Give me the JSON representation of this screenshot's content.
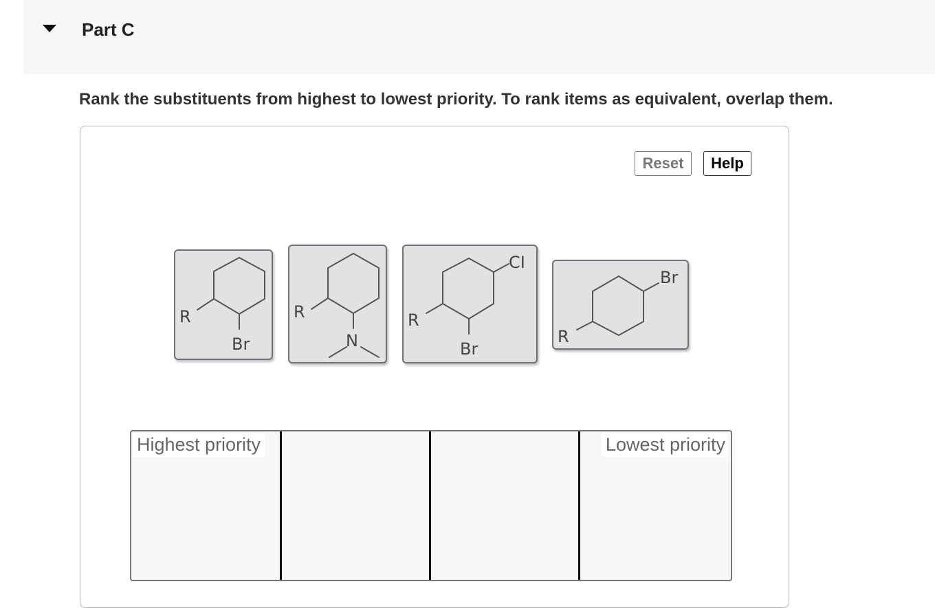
{
  "part": {
    "title": "Part C",
    "expanded": true
  },
  "instructions": "Rank the substituents from highest to lowest priority. To rank items as equivalent, overlap them.",
  "controls": {
    "reset_label": "Reset",
    "help_label": "Help"
  },
  "items": [
    {
      "id": "item-1",
      "labels": [
        "R",
        "Br"
      ]
    },
    {
      "id": "item-2",
      "labels": [
        "R",
        "N"
      ]
    },
    {
      "id": "item-3",
      "labels": [
        "R",
        "CI",
        "Br"
      ]
    },
    {
      "id": "item-4",
      "labels": [
        "Br",
        "R"
      ]
    }
  ],
  "ranking": {
    "highest_label": "Highest priority",
    "lowest_label": "Lowest priority",
    "bin_count": 4
  }
}
